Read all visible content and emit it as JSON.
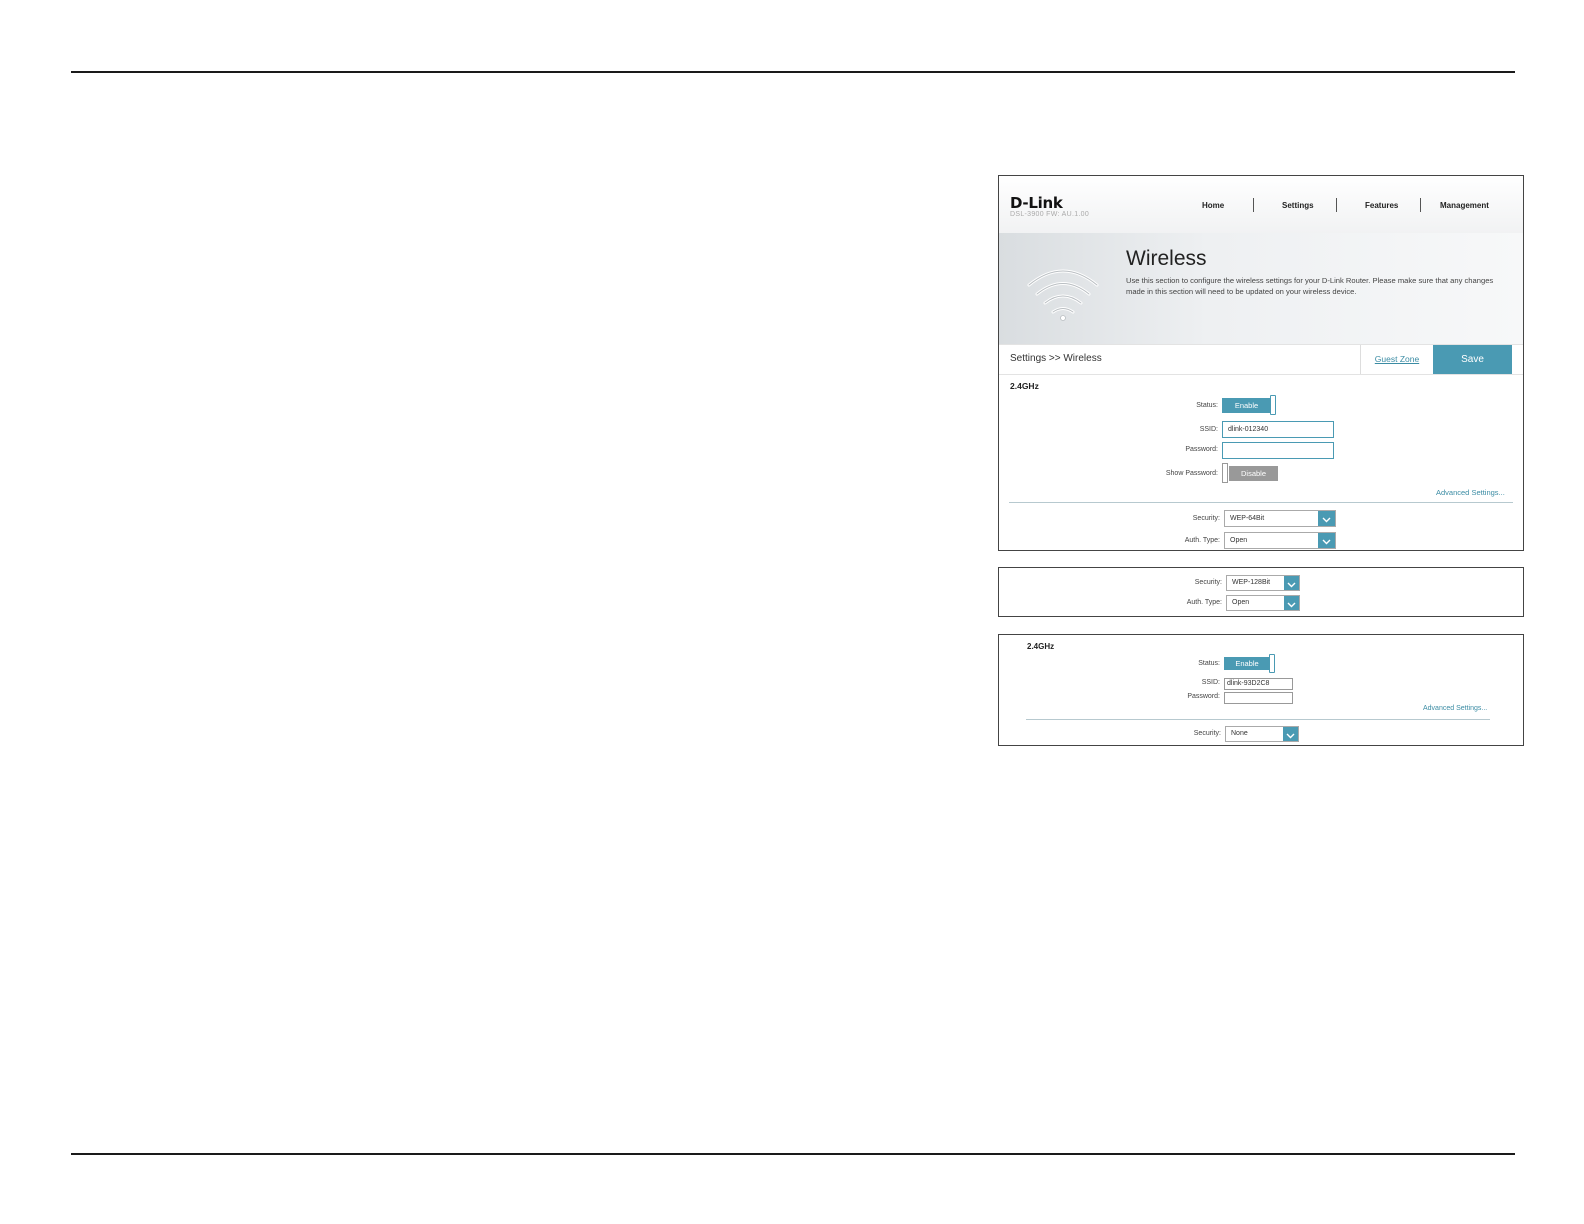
{
  "header": {
    "logo": "D-Link",
    "model": "DSL-3900  FW: AU.1.00",
    "nav": [
      "Home",
      "Settings",
      "Features",
      "Management"
    ]
  },
  "banner": {
    "title": "Wireless",
    "description": "Use this section to configure the wireless settings for your D-Link Router. Please make sure that any changes made in this section will need to be updated on your wireless device."
  },
  "breadcrumb": "Settings >> Wireless",
  "guest_zone_label": "Guest Zone",
  "save_label": "Save",
  "main_form": {
    "band": "2.4GHz",
    "status_label": "Status:",
    "status_value": "Enable",
    "ssid_label": "SSID:",
    "ssid_value": "dlink-012340",
    "password_label": "Password:",
    "password_value": "",
    "show_password_label": "Show Password:",
    "show_password_value": "Disable",
    "advanced_link": "Advanced Settings...",
    "security_label": "Security:",
    "security_value": "WEP-64Bit",
    "auth_label": "Auth. Type:",
    "auth_value": "Open"
  },
  "wep128_form": {
    "security_label": "Security:",
    "security_value": "WEP-128Bit",
    "auth_label": "Auth. Type:",
    "auth_value": "Open"
  },
  "none_form": {
    "band": "2.4GHz",
    "status_label": "Status:",
    "status_value": "Enable",
    "ssid_label": "SSID:",
    "ssid_value": "dlink-93D2C8",
    "password_label": "Password:",
    "password_value": "",
    "advanced_link": "Advanced Settings...",
    "security_label": "Security:",
    "security_value": "None"
  },
  "colors": {
    "accent": "#4a9ab3",
    "link": "#3b8ca4",
    "disabled": "#999999"
  },
  "icons": [
    "wifi-icon",
    "chevron-down-icon"
  ]
}
